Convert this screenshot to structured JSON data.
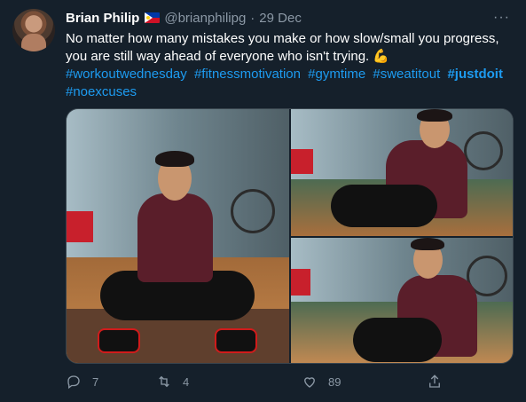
{
  "tweet": {
    "author_name": "Brian Philip",
    "handle": "@brianphilipg",
    "separator": "·",
    "date": "29 Dec",
    "more_label": "···",
    "text_line1": "No matter how many mistakes you make or how slow/small you progress,",
    "text_line2": "you are still way ahead of everyone who isn't trying. 💪",
    "hashtags": [
      "#workoutwednesday",
      "#fitnessmotivation",
      "#gymtime",
      "#sweatitout",
      "#justdoit",
      "#noexcuses"
    ],
    "reply_count": "7",
    "retweet_count": "4",
    "like_count": "89"
  },
  "icons": {
    "reply": "reply-icon",
    "retweet": "retweet-icon",
    "like": "heart-icon",
    "share": "share-icon",
    "flag": "philippines-flag-icon",
    "more": "more-icon"
  },
  "colors": {
    "background": "#15202b",
    "text": "#ffffff",
    "secondary": "#8b98a5",
    "link": "#1d9bf0",
    "border": "#38444d"
  }
}
